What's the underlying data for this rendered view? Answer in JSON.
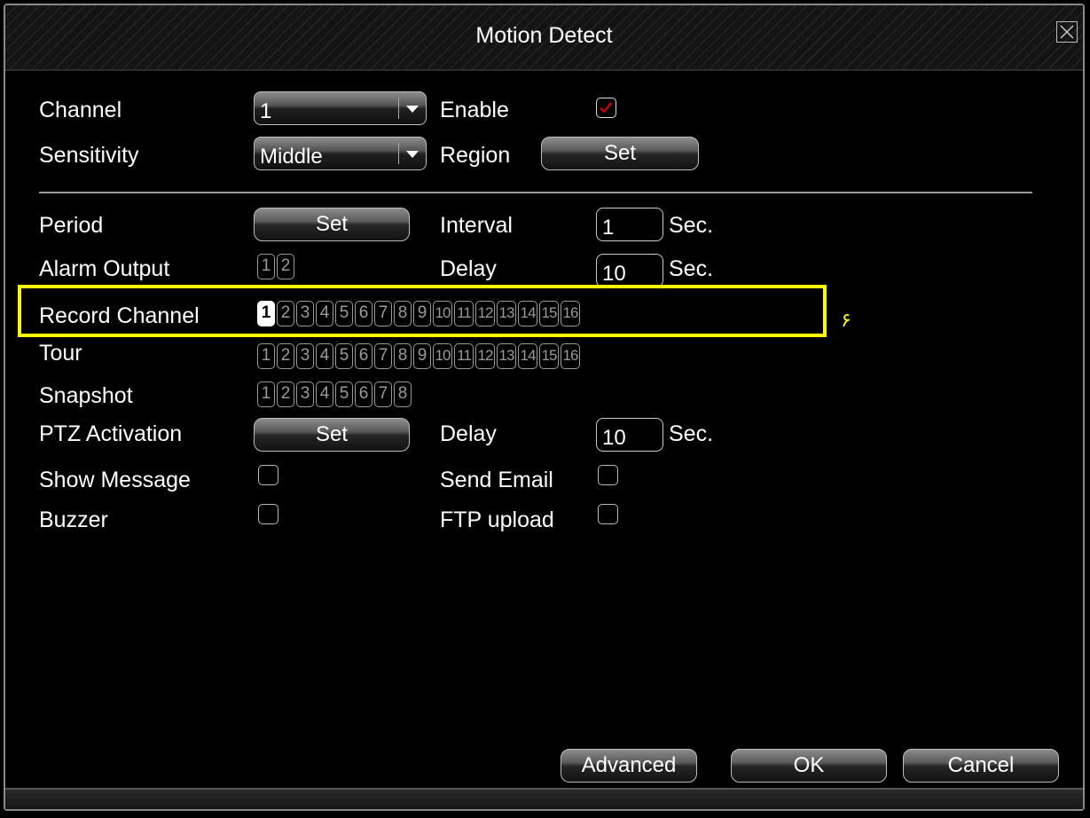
{
  "window": {
    "title": "Motion Detect"
  },
  "channel": {
    "label": "Channel",
    "value": "1"
  },
  "enable": {
    "label": "Enable",
    "checked": true
  },
  "sensitivity": {
    "label": "Sensitivity",
    "value": "Middle"
  },
  "region": {
    "label": "Region",
    "button": "Set"
  },
  "period": {
    "label": "Period",
    "button": "Set"
  },
  "interval": {
    "label": "Interval",
    "value": "1",
    "unit": "Sec."
  },
  "alarm_output": {
    "label": "Alarm Output",
    "items": [
      "1",
      "2"
    ]
  },
  "delay": {
    "label": "Delay",
    "value": "10",
    "unit": "Sec."
  },
  "record_channel": {
    "label": "Record Channel",
    "selected": [
      "1"
    ],
    "items": [
      "1",
      "2",
      "3",
      "4",
      "5",
      "6",
      "7",
      "8",
      "9",
      "10",
      "11",
      "12",
      "13",
      "14",
      "15",
      "16"
    ]
  },
  "tour": {
    "label": "Tour",
    "items": [
      "1",
      "2",
      "3",
      "4",
      "5",
      "6",
      "7",
      "8",
      "9",
      "10",
      "11",
      "12",
      "13",
      "14",
      "15",
      "16"
    ]
  },
  "snapshot": {
    "label": "Snapshot",
    "items": [
      "1",
      "2",
      "3",
      "4",
      "5",
      "6",
      "7",
      "8"
    ]
  },
  "ptz": {
    "label": "PTZ Activation",
    "button": "Set"
  },
  "ptz_delay": {
    "label": "Delay",
    "value": "10",
    "unit": "Sec."
  },
  "show_message": {
    "label": "Show Message",
    "checked": false
  },
  "send_email": {
    "label": "Send Email",
    "checked": false
  },
  "buzzer": {
    "label": "Buzzer",
    "checked": false
  },
  "ftp_upload": {
    "label": "FTP upload",
    "checked": false
  },
  "footer": {
    "advanced": "Advanced",
    "ok": "OK",
    "cancel": "Cancel"
  },
  "annotation": {
    "text": "۶",
    "color": "#ffff00"
  },
  "icons": {
    "close": "close-icon",
    "checkmark": "checkmark-icon",
    "dropdown": "chevron-down-icon"
  }
}
